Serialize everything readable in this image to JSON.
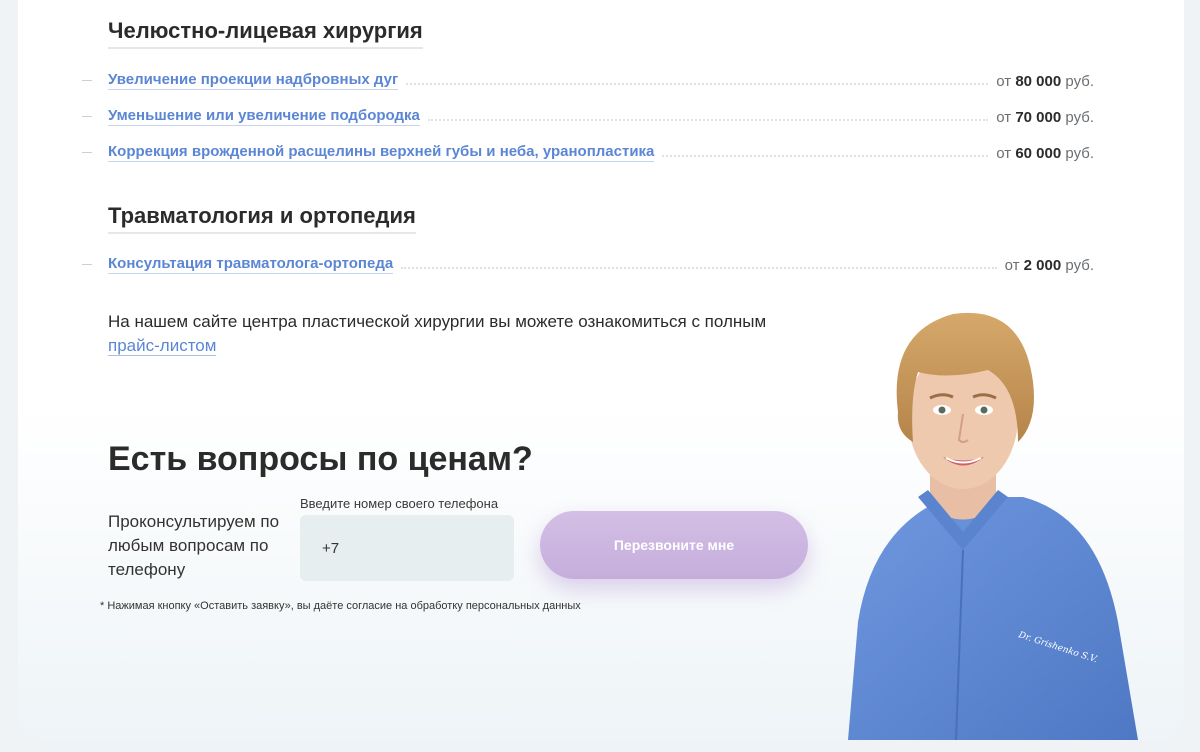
{
  "sections": [
    {
      "title": "Челюстно-лицевая хирургия",
      "items": [
        {
          "name": "Увеличение проекции надбровных дуг",
          "prefix": "от",
          "amount": "80 000",
          "currency": "руб."
        },
        {
          "name": "Уменьшение или увеличение подбородка",
          "prefix": "от",
          "amount": "70 000",
          "currency": "руб."
        },
        {
          "name": "Коррекция врожденной расщелины верхней губы и неба, уранопластика",
          "prefix": "от",
          "amount": "60 000",
          "currency": "руб."
        }
      ]
    },
    {
      "title": "Травматология и ортопедия",
      "items": [
        {
          "name": "Консультация травматолога-ортопеда",
          "prefix": "от",
          "amount": "2 000",
          "currency": "руб."
        }
      ]
    }
  ],
  "note": {
    "text": "На нашем сайте центра пластической хирургии вы можете ознакомиться с полным",
    "link": "прайс-листом"
  },
  "cta": {
    "title": "Есть вопросы по ценам?",
    "subtitle": "Проконсультируем по любым вопросам по телефону",
    "phone_label": "Введите номер своего телефона",
    "phone_value": "+7",
    "button_label": "Перезвоните мне",
    "disclaimer": "* Нажимая кнопку «Оставить заявку», вы даёте согласие на обработку персональных данных"
  },
  "doctor_badge": "Dr. Grishenko S.V.",
  "colors": {
    "link": "#5b86d4",
    "button": "#c8b2de",
    "scrubs": "#5f8bd6"
  }
}
